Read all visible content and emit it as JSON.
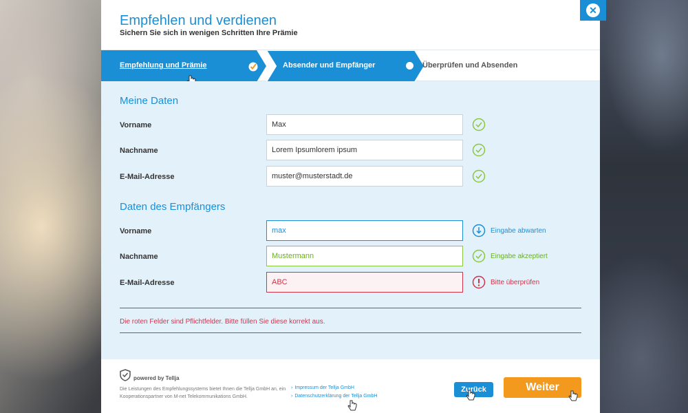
{
  "modal": {
    "title": "Empfehlen und verdienen",
    "subtitle": "Sichern Sie sich in wenigen Schritten Ihre Prämie",
    "close_icon": "close-icon"
  },
  "steps": [
    {
      "label": "Empfehlung und Prämie",
      "state": "done"
    },
    {
      "label": "Absender und Empfänger",
      "state": "current"
    },
    {
      "label": "Überprüfen und Absenden",
      "state": "upcoming"
    }
  ],
  "sender": {
    "section_title": "Meine Daten",
    "fields": [
      {
        "label": "Vorname",
        "value": "Max",
        "status": "ok"
      },
      {
        "label": "Nachname",
        "value": "Lorem Ipsumlorem ipsum",
        "status": "ok"
      },
      {
        "label": "E-Mail-Adresse",
        "value": "muster@musterstadt.de",
        "status": "ok"
      }
    ]
  },
  "recipient": {
    "section_title": "Daten des Empfängers",
    "fields": [
      {
        "label": "Vorname",
        "value": "max",
        "status": "pending",
        "status_text": "Eingabe abwarten"
      },
      {
        "label": "Nachname",
        "value": "Mustermann",
        "status": "ok",
        "status_text": "Eingabe akzeptiert"
      },
      {
        "label": "E-Mail-Adresse",
        "value": "ABC",
        "status": "error",
        "status_text": "Bitte überprüfen"
      }
    ]
  },
  "error_message": "Die roten Felder sind Pflichtfelder. Bitte füllen Sie diese korrekt aus.",
  "footer": {
    "powered_by": "powered by Tellja",
    "info_text": "Die Leistungen des Empfehlungssystems bietet Ihnen die Tellja GmbH an, ein Kooperationspartner von M-net Telekommunikations GmbH.",
    "links": [
      "Impressum der Tellja GmbH",
      "Datenschutzerklärung der Tellja GmbH"
    ],
    "back_label": "Zurück",
    "next_label": "Weiter"
  },
  "colors": {
    "primary": "#1a8fd6",
    "accent": "#f39a1e",
    "success": "#8cc63f",
    "error": "#d0344a",
    "panel": "#e3f1fa"
  }
}
